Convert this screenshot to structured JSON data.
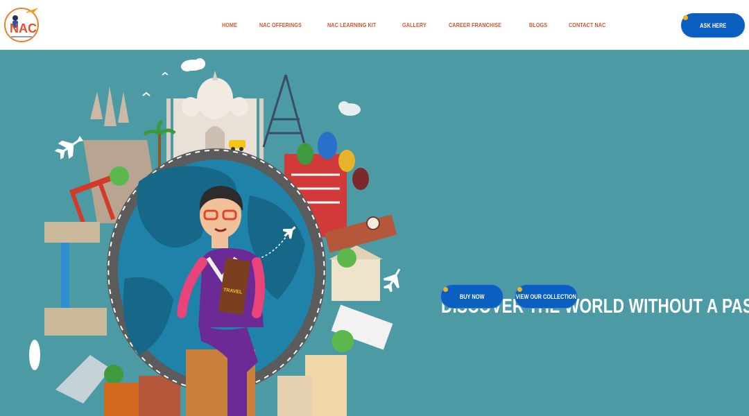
{
  "header": {
    "logo_text": "NAC",
    "nav": [
      {
        "label": "HOME"
      },
      {
        "label": "NAC OFFERINGS"
      },
      {
        "label": "NAC LEARNING KIT"
      },
      {
        "label": "GALLERY"
      },
      {
        "label": "CAREER FRANCHISE"
      },
      {
        "label": "BLOGS"
      },
      {
        "label": "CONTACT NAC"
      }
    ],
    "ask_label": "ASK HERE"
  },
  "hero": {
    "headline": "DISCOVER THE WORLD WITHOUT A PASSPORT !!",
    "buy_label": "BUY NOW",
    "collection_label": "VIEW OUR COLLECTION",
    "book_label": "TRAVEL"
  },
  "colors": {
    "background": "#4c9aa3",
    "nav_text": "#e0512b",
    "button": "#0a5fc0",
    "accent_dot": "#f2b51c"
  }
}
